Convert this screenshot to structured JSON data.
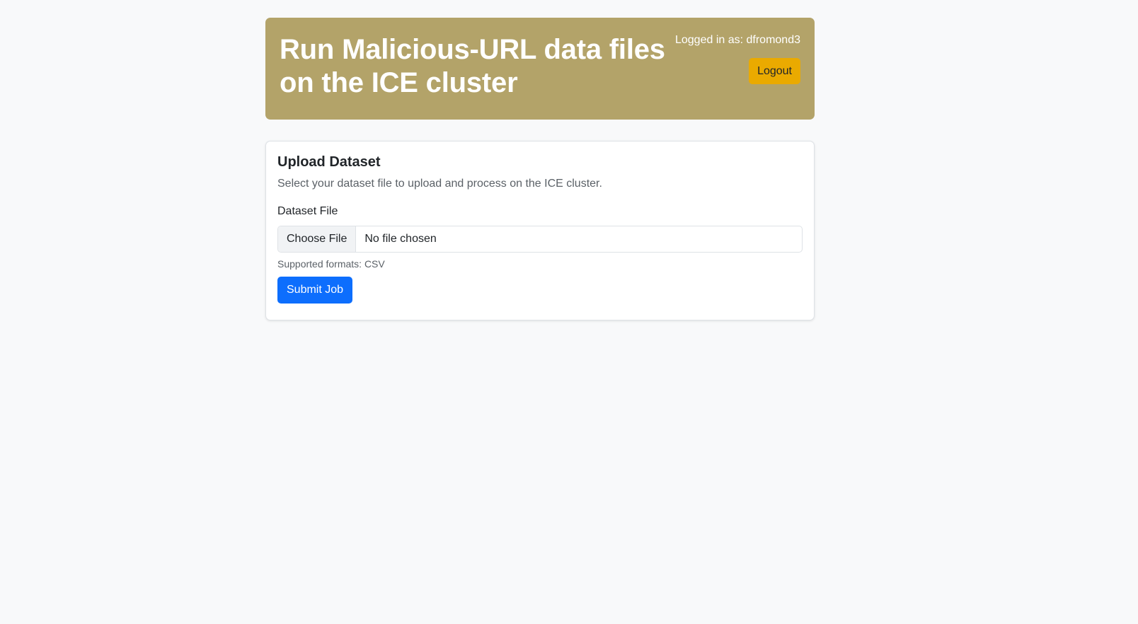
{
  "header": {
    "title": "Run Malicious-URL data files on the ICE cluster",
    "logged_in_text": "Logged in as: dfromond3",
    "logout_label": "Logout"
  },
  "upload_card": {
    "title": "Upload Dataset",
    "description": "Select your dataset file to upload and process on the ICE cluster.",
    "field_label": "Dataset File",
    "choose_file_label": "Choose File",
    "file_status": "No file chosen",
    "help_text": "Supported formats: CSV",
    "submit_label": "Submit Job"
  },
  "colors": {
    "page_background": "#f8f9fa",
    "header_background": "#b3a369",
    "logout_button": "#eaaa00",
    "submit_button": "#0d6efd"
  }
}
